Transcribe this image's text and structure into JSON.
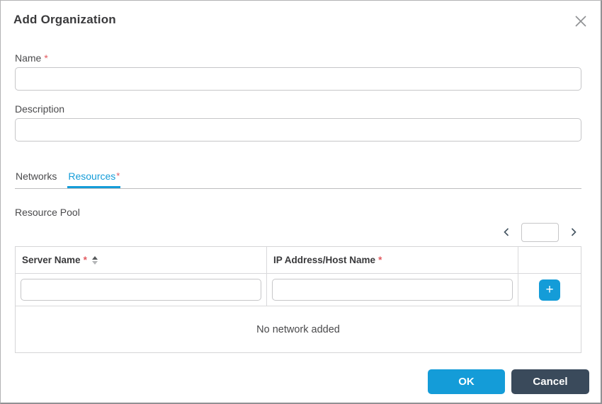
{
  "dialog": {
    "title": "Add Organization"
  },
  "required_marker": "*",
  "fields": {
    "name": {
      "label": "Name",
      "required": true,
      "value": "",
      "placeholder": ""
    },
    "description": {
      "label": "Description",
      "required": false,
      "value": "",
      "placeholder": ""
    }
  },
  "tabs": [
    {
      "label": "Networks",
      "active": false,
      "required": false
    },
    {
      "label": "Resources",
      "active": true,
      "required": true
    }
  ],
  "resource_pool": {
    "label": "Resource Pool",
    "pagination": {
      "prev_icon": "chevron-left",
      "next_icon": "chevron-right",
      "page_value": ""
    },
    "table": {
      "columns": [
        {
          "label": "Server Name",
          "required": true,
          "sortable": true,
          "sort_state": "asc"
        },
        {
          "label": "IP Address/Host Name",
          "required": true
        },
        {
          "label": ""
        }
      ],
      "new_row": {
        "server_name_value": "",
        "ip_address_value": "",
        "add_button_label": "+"
      },
      "empty_text": "No network added"
    }
  },
  "footer": {
    "ok_label": "OK",
    "cancel_label": "Cancel"
  },
  "colors": {
    "accent_blue": "#149cd8",
    "dark_button": "#3a4a5b",
    "required_red": "#e2595f",
    "border_gray": "#c6c6c8"
  }
}
